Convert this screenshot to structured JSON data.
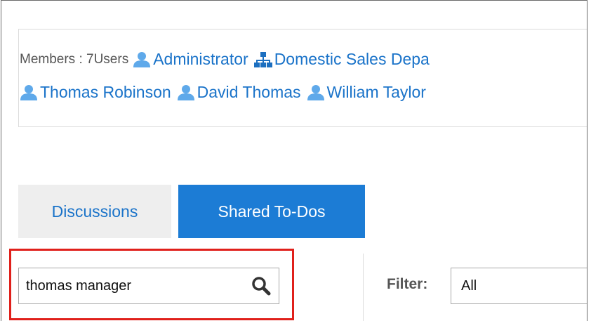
{
  "members": {
    "label": "Members : 7Users",
    "line1": [
      {
        "name": "Administrator",
        "icon": "user-icon"
      },
      {
        "name": "Domestic Sales Depa",
        "icon": "organization-icon"
      }
    ],
    "line2": [
      {
        "name": "Thomas Robinson",
        "icon": "user-icon"
      },
      {
        "name": "David Thomas",
        "icon": "user-icon"
      },
      {
        "name": "William Taylor",
        "icon": "user-icon"
      }
    ]
  },
  "tabs": [
    {
      "label": "Discussions",
      "active": false
    },
    {
      "label": "Shared To-Dos",
      "active": true
    }
  ],
  "search": {
    "value": "thomas manager",
    "icon": "search-icon"
  },
  "filter": {
    "label": "Filter:",
    "selected": "All"
  },
  "colors": {
    "link": "#1a73c9",
    "active_tab": "#1c7cd5",
    "highlight": "#e0201b",
    "user_icon": "#5fa9ea"
  }
}
